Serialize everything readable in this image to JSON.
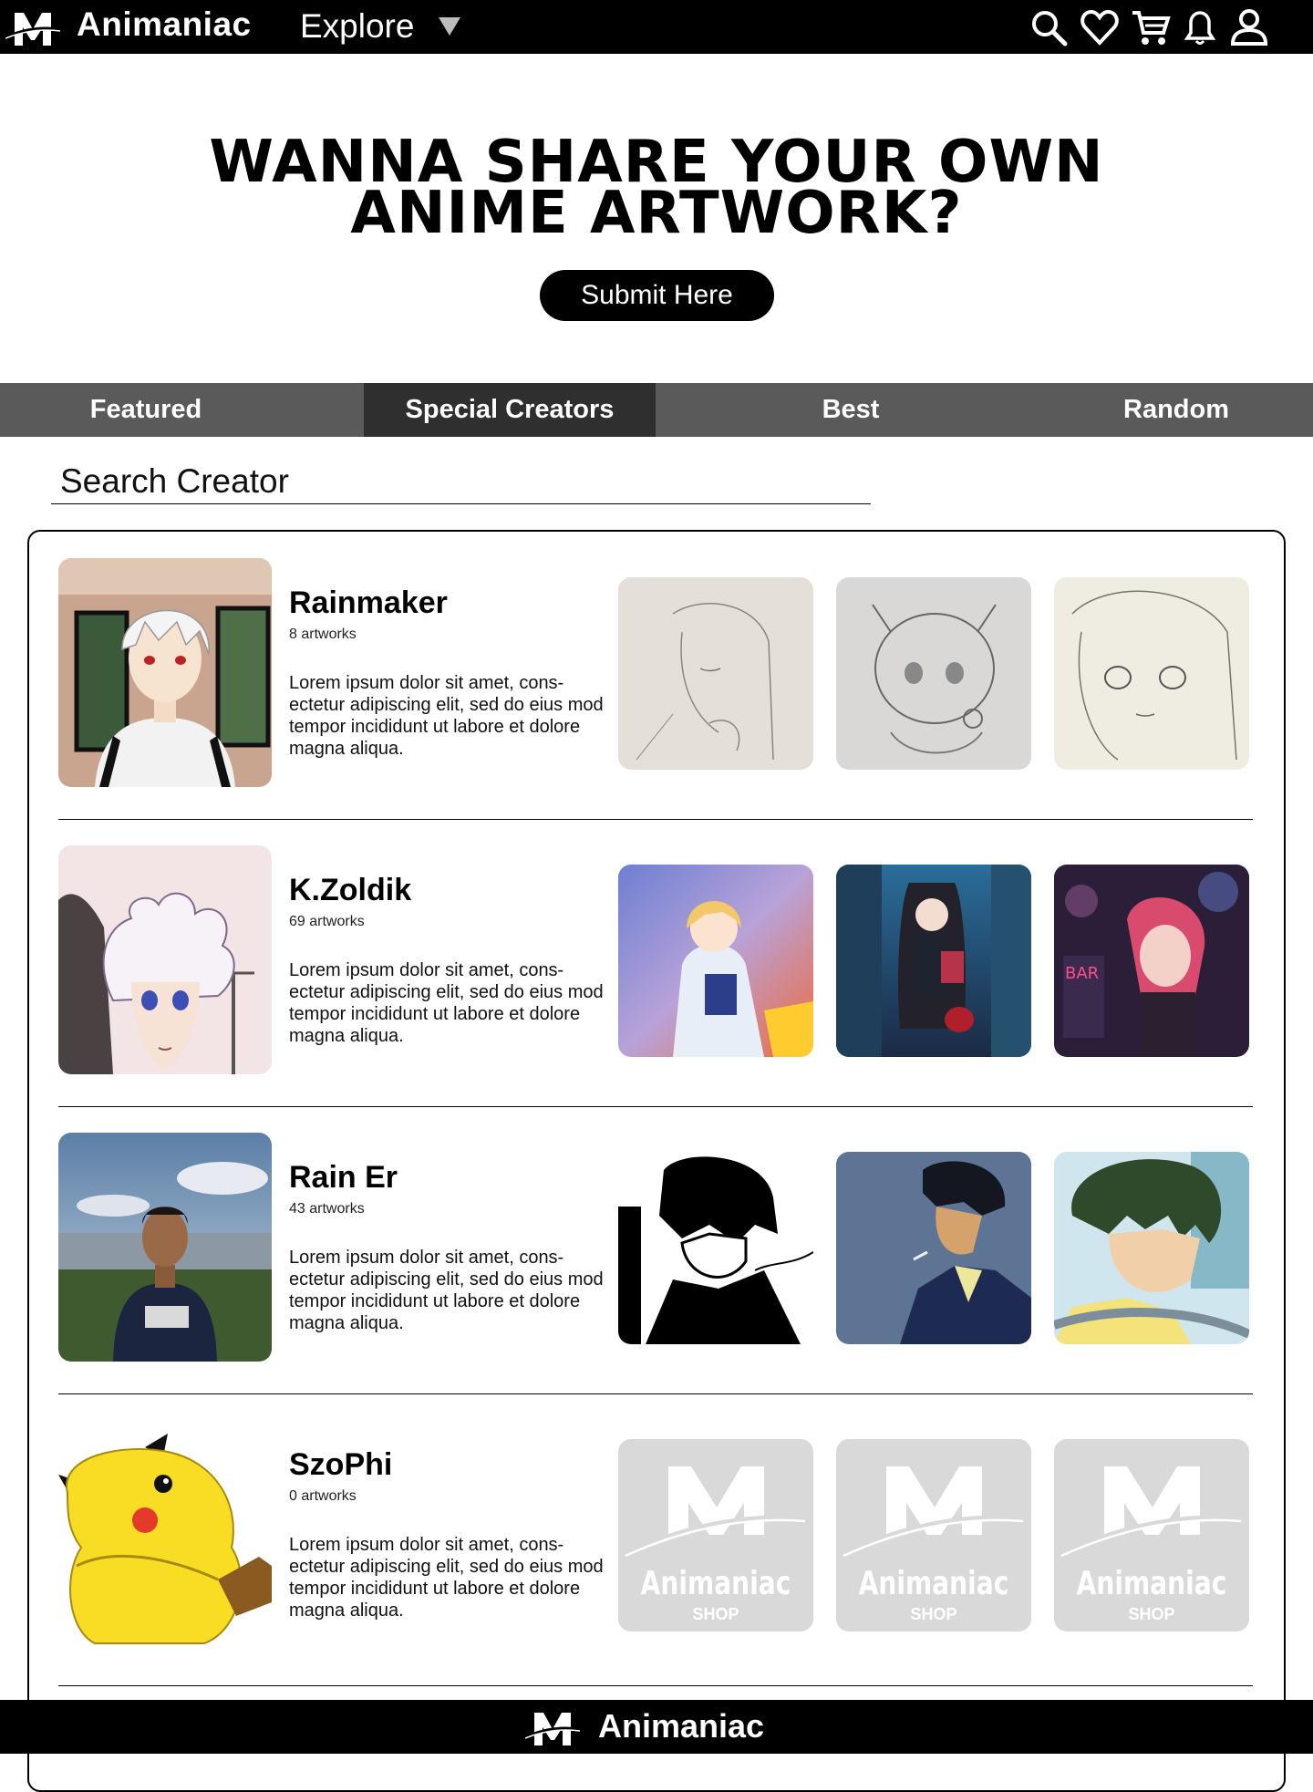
{
  "nav": {
    "brand": "Animaniac",
    "explore_label": "Explore",
    "icons": [
      "search-icon",
      "heart-icon",
      "cart-icon",
      "bell-icon",
      "user-icon"
    ]
  },
  "hero": {
    "title_line1": "WANNA SHARE YOUR OWN",
    "title_line2": "ANIME ARTWORK?",
    "submit_label": "Submit Here"
  },
  "tabs": [
    {
      "label": "Featured",
      "active": false
    },
    {
      "label": "Special Creators",
      "active": true
    },
    {
      "label": "Best",
      "active": false
    },
    {
      "label": "Random",
      "active": false
    }
  ],
  "search": {
    "placeholder": "Search Creator"
  },
  "creators": [
    {
      "name": "Rainmaker",
      "artworks": "8 artworks",
      "description": "Lorem ipsum dolor sit amet, cons-ectetur adipiscing elit, sed do eius mod tempor incididunt ut labore et dolore magna aliqua."
    },
    {
      "name": "K.Zoldik",
      "artworks": "69 artworks",
      "description": "Lorem ipsum dolor sit amet, cons-ectetur adipiscing elit, sed do eius mod tempor incididunt ut labore et dolore magna aliqua."
    },
    {
      "name": "Rain Er",
      "artworks": "43 artworks",
      "description": "Lorem ipsum dolor sit amet, cons-ectetur adipiscing elit, sed do eius mod tempor incididunt ut labore et dolore magna aliqua."
    },
    {
      "name": "SzoPhi",
      "artworks": "0 artworks",
      "description": "Lorem ipsum dolor sit amet, cons-ectetur adipiscing elit, sed do eius mod tempor incididunt ut labore et dolore magna aliqua."
    }
  ],
  "placeholder_thumb": {
    "brand": "Animaniac",
    "sub": "SHOP"
  },
  "footer": {
    "brand": "Animaniac"
  },
  "colors": {
    "nav_bg": "#000000",
    "tab_bg": "#5a5a5a",
    "tab_active": "#2f2f2f",
    "placeholder_bg": "#d9d9d9"
  }
}
